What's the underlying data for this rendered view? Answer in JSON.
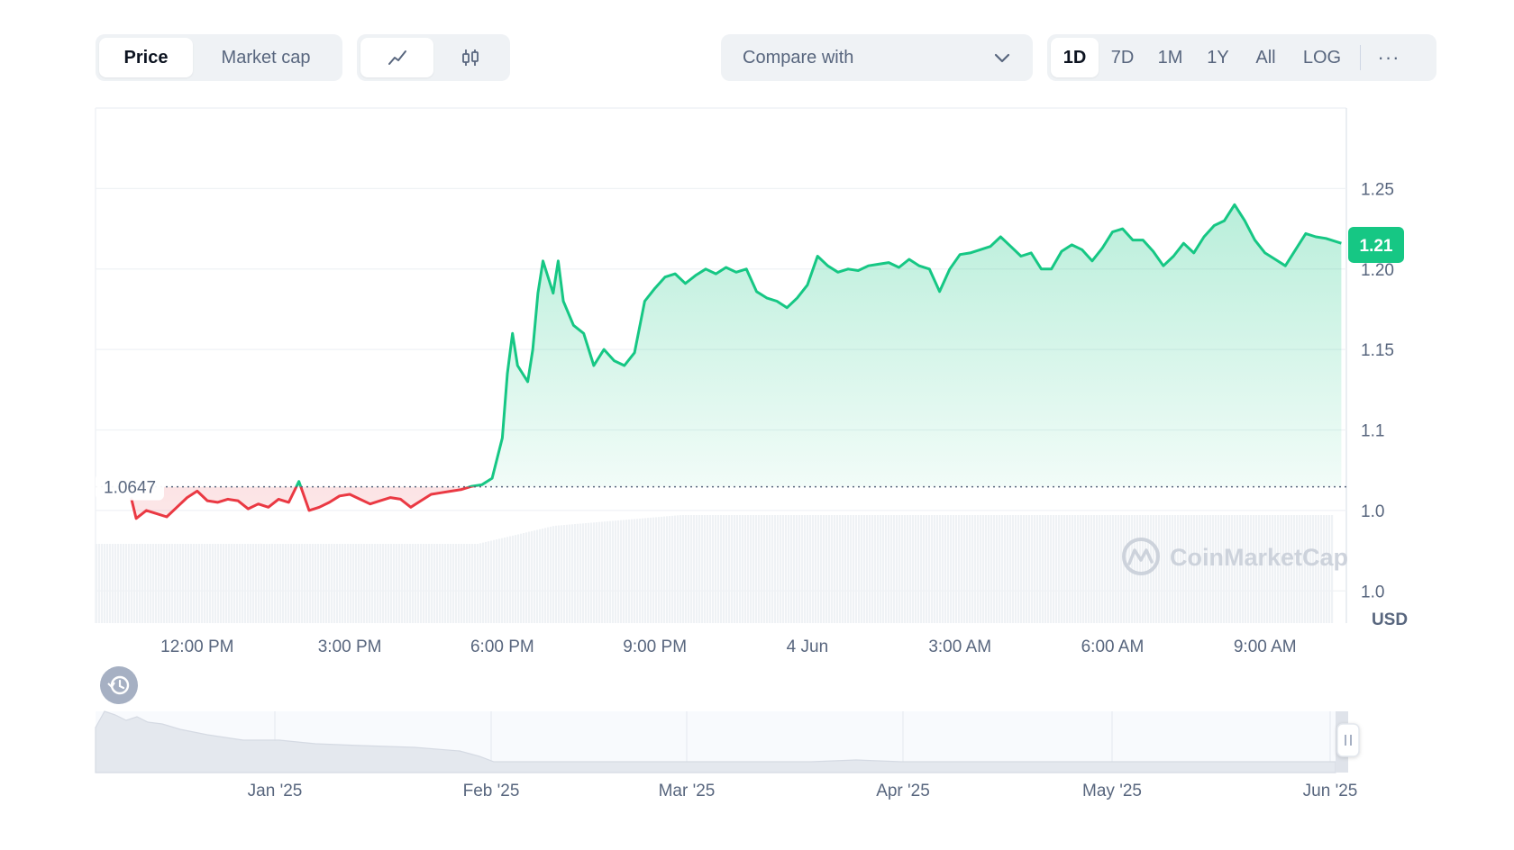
{
  "toolbar": {
    "price_label": "Price",
    "market_cap_label": "Market cap",
    "line_icon": "line-chart-icon",
    "candle_icon": "candlestick-icon",
    "compare_label": "Compare with",
    "ranges": [
      "1D",
      "7D",
      "1M",
      "1Y",
      "All"
    ],
    "active_range": "1D",
    "log_label": "LOG",
    "more_label": "···"
  },
  "chart_data": {
    "type": "line",
    "y_ticks": [
      "1.25",
      "1.20",
      "1.15",
      "1.1",
      "1.0",
      "1.0"
    ],
    "y_tick_values": [
      1.25,
      1.2,
      1.15,
      1.1,
      1.05,
      1.0
    ],
    "ylim": [
      0.98,
      1.3
    ],
    "x_ticks": [
      "12:00 PM",
      "3:00 PM",
      "6:00 PM",
      "9:00 PM",
      "4 Jun",
      "3:00 AM",
      "6:00 AM",
      "9:00 AM"
    ],
    "x_tick_hours": [
      12,
      15,
      18,
      21,
      24,
      27,
      30,
      33
    ],
    "xlim_hours": [
      10.0,
      34.6
    ],
    "currency_label": "USD",
    "reference_price": 1.0647,
    "reference_label": "1.0647",
    "current_price_label": "1.21",
    "current_price": 1.215,
    "up_color": "#16c784",
    "down_color": "#ea3943",
    "grid": true,
    "watermark": "CoinMarketCap",
    "series": [
      {
        "x": [
          10.7,
          10.8,
          11.0,
          11.2,
          11.4,
          11.6,
          11.8,
          12.0,
          12.2,
          12.4,
          12.6,
          12.8,
          13.0,
          13.2,
          13.4,
          13.6,
          13.8,
          14.0,
          14.2,
          14.4,
          14.6,
          14.8,
          15.0,
          15.2,
          15.4,
          15.6,
          15.8,
          16.0,
          16.2,
          16.4,
          16.6,
          16.8,
          17.0,
          17.2,
          17.4,
          17.6,
          17.8,
          18.0,
          18.1,
          18.2,
          18.3,
          18.5,
          18.6,
          18.7,
          18.8,
          19.0,
          19.1,
          19.2,
          19.4,
          19.6,
          19.8,
          20.0,
          20.2,
          20.4,
          20.6,
          20.8,
          21.0,
          21.2,
          21.4,
          21.6,
          21.8,
          22.0,
          22.2,
          22.4,
          22.6,
          22.8,
          23.0,
          23.2,
          23.4,
          23.6,
          23.8,
          24.0,
          24.2,
          24.4,
          24.6,
          24.8,
          25.0,
          25.2,
          25.4,
          25.6,
          25.8,
          26.0,
          26.2,
          26.4,
          26.6,
          26.8,
          27.0,
          27.2,
          27.4,
          27.6,
          27.8,
          28.0,
          28.2,
          28.4,
          28.6,
          28.8,
          29.0,
          29.2,
          29.4,
          29.6,
          29.8,
          30.0,
          30.2,
          30.4,
          30.6,
          30.8,
          31.0,
          31.2,
          31.4,
          31.6,
          31.8,
          32.0,
          32.2,
          32.4,
          32.6,
          32.8,
          33.0,
          33.2,
          33.4,
          33.6,
          33.8,
          34.0,
          34.2,
          34.5
        ],
        "y": [
          1.058,
          1.045,
          1.05,
          1.048,
          1.046,
          1.052,
          1.058,
          1.062,
          1.056,
          1.055,
          1.057,
          1.056,
          1.051,
          1.054,
          1.052,
          1.057,
          1.055,
          1.068,
          1.05,
          1.052,
          1.055,
          1.059,
          1.06,
          1.057,
          1.054,
          1.056,
          1.058,
          1.057,
          1.052,
          1.056,
          1.06,
          1.061,
          1.062,
          1.063,
          1.065,
          1.066,
          1.07,
          1.095,
          1.135,
          1.16,
          1.14,
          1.13,
          1.15,
          1.185,
          1.205,
          1.185,
          1.205,
          1.18,
          1.165,
          1.16,
          1.14,
          1.15,
          1.143,
          1.14,
          1.148,
          1.18,
          1.188,
          1.195,
          1.197,
          1.191,
          1.196,
          1.2,
          1.197,
          1.201,
          1.198,
          1.2,
          1.186,
          1.182,
          1.18,
          1.176,
          1.182,
          1.19,
          1.208,
          1.202,
          1.198,
          1.2,
          1.199,
          1.202,
          1.203,
          1.204,
          1.201,
          1.206,
          1.202,
          1.2,
          1.186,
          1.2,
          1.209,
          1.21,
          1.212,
          1.214,
          1.22,
          1.214,
          1.208,
          1.21,
          1.2,
          1.2,
          1.211,
          1.215,
          1.212,
          1.205,
          1.213,
          1.223,
          1.225,
          1.218,
          1.218,
          1.211,
          1.202,
          1.208,
          1.216,
          1.21,
          1.22,
          1.227,
          1.23,
          1.24,
          1.23,
          1.218,
          1.21,
          1.206,
          1.202,
          1.212,
          1.222,
          1.22,
          1.219,
          1.216
        ]
      }
    ]
  },
  "navigator": {
    "labels": [
      "Jan '25",
      "Feb '25",
      "Mar '25",
      "Apr '25",
      "May '25",
      "Jun '25"
    ],
    "history_icon": "history-icon",
    "handle_icon": "drag-handle-icon"
  }
}
